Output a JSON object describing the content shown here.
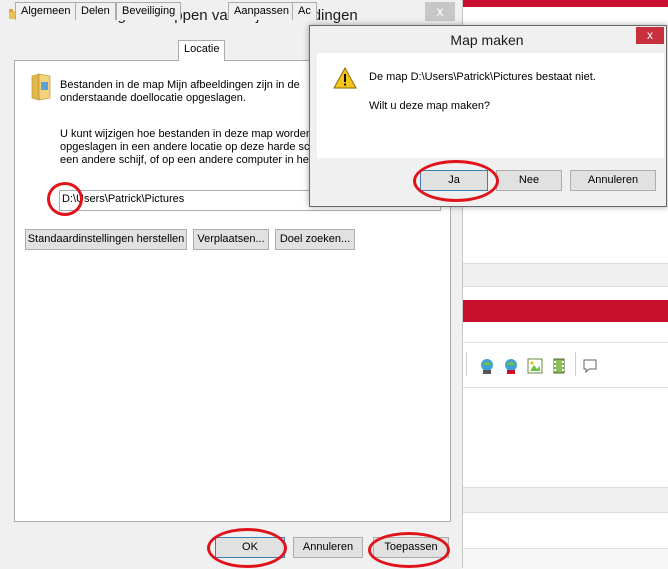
{
  "main_dialog": {
    "title": "Eigenschappen van Mijn afbeeldingen",
    "close_label": "x",
    "tabs": [
      "Algemeen",
      "Delen",
      "Beveiliging",
      "Locatie",
      "Aanpassen",
      "Ac"
    ],
    "active_tab": "Locatie",
    "description_line1": "Bestanden in de map Mijn afbeeldingen zijn in de",
    "description_line2": "onderstaande doellocatie opgeslagen.",
    "change_line1": "U kunt wijzigen hoe bestanden in deze map worden",
    "change_line2": "opgeslagen in een andere locatie op deze harde schi",
    "change_line3": "een andere schijf, of op een andere computer in het n",
    "path_value": "D:\\Users\\Patrick\\Pictures",
    "restore_button": "Standaardinstellingen herstellen",
    "move_button": "Verplaatsen...",
    "find_target_button": "Doel zoeken...",
    "ok_button": "OK",
    "cancel_button": "Annuleren",
    "apply_button": "Toepassen"
  },
  "popup": {
    "title": "Map maken",
    "close_label": "x",
    "message": "De map D:\\Users\\Patrick\\Pictures bestaat niet.",
    "question": "Wilt u deze map maken?",
    "yes_button": "Ja",
    "no_button": "Nee",
    "cancel_button": "Annuleren"
  },
  "icons": [
    "folder-icon",
    "warning-icon",
    "app-icon",
    "close-icon",
    "globe-icon",
    "image-icon",
    "film-icon",
    "comment-icon"
  ],
  "colors": {
    "highlight_ring": "#e0131b",
    "popup_close": "#c7303c",
    "brand_red": "#c8102e",
    "default_button_border": "#3c7fb1"
  }
}
